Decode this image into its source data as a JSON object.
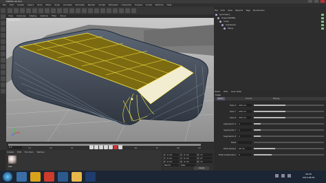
{
  "window": {
    "title": "CINEMA 4D R13"
  },
  "menu": [
    "File",
    "Edit",
    "Create",
    "Select",
    "Tools",
    "Mesh",
    "Snap",
    "Animate",
    "Simulate",
    "Render",
    "Sculpt",
    "MoGraph",
    "Character",
    "Plugins",
    "Script",
    "Window",
    "Help"
  ],
  "viewport": {
    "menu": [
      "View",
      "Cameras",
      "Display",
      "Options",
      "Filter",
      "Panel"
    ],
    "label": "Perspective"
  },
  "timeline": {
    "ticks": [
      "0",
      "10",
      "20",
      "30",
      "40",
      "50",
      "60",
      "70",
      "80",
      "90"
    ],
    "frame": "0 F"
  },
  "materials": {
    "tabs": [
      "Create",
      "Edit",
      "Function",
      "Texture"
    ],
    "name": "Mat"
  },
  "coords": {
    "rows": [
      [
        "X",
        "0 cm",
        "X",
        "0 cm",
        "H",
        "0°"
      ],
      [
        "Y",
        "0 cm",
        "Y",
        "0 cm",
        "P",
        "0°"
      ],
      [
        "Z",
        "0 cm",
        "Z",
        "0 cm",
        "B",
        "0°"
      ]
    ],
    "world": "World",
    "scale": "Size",
    "apply": "Apply"
  },
  "objects": {
    "tabs": [
      "File",
      "Edit",
      "View",
      "Objects",
      "Tags",
      "Bookmarks"
    ],
    "items": [
      "Symmetry",
      "Hyper-NURBS",
      "Cube",
      "Subdivide",
      "Plane"
    ]
  },
  "attributes": {
    "tabs": [
      "Mode",
      "Edit",
      "User Data"
    ],
    "header": "Cube",
    "section_tabs": [
      "Basic",
      "Coord.",
      "Phong"
    ],
    "rows": [
      {
        "label": "Size X",
        "value": "200 cm",
        "fill": 0.45
      },
      {
        "label": "Size Y",
        "value": "200 cm",
        "fill": 0.45
      },
      {
        "label": "Size Z",
        "value": "200 cm",
        "fill": 0.45
      },
      {
        "label": "Segments X",
        "value": "1",
        "fill": 0.1
      },
      {
        "label": "Segments Y",
        "value": "1",
        "fill": 0.1
      },
      {
        "label": "Segments Z",
        "value": "1",
        "fill": 0.1
      },
      {
        "label": "Fillet",
        "value": "",
        "fill": 0
      },
      {
        "label": "Fillet Radius",
        "value": "40 cm",
        "fill": 0.3
      },
      {
        "label": "Fillet Subdivision",
        "value": "5",
        "fill": 0.25
      }
    ]
  },
  "taskbar": {
    "time": "09:25",
    "date": "2013-08-30",
    "icons": [
      "explorer-icon",
      "media-icon",
      "chrome-icon",
      "cinema4d-icon",
      "folder-icon",
      "photoshop-icon"
    ],
    "icon_colors": [
      "#3a6ea5",
      "#d9a21b",
      "#cc3b2b",
      "#2d5a8c",
      "#e6b84a",
      "#1e3d6e"
    ]
  }
}
